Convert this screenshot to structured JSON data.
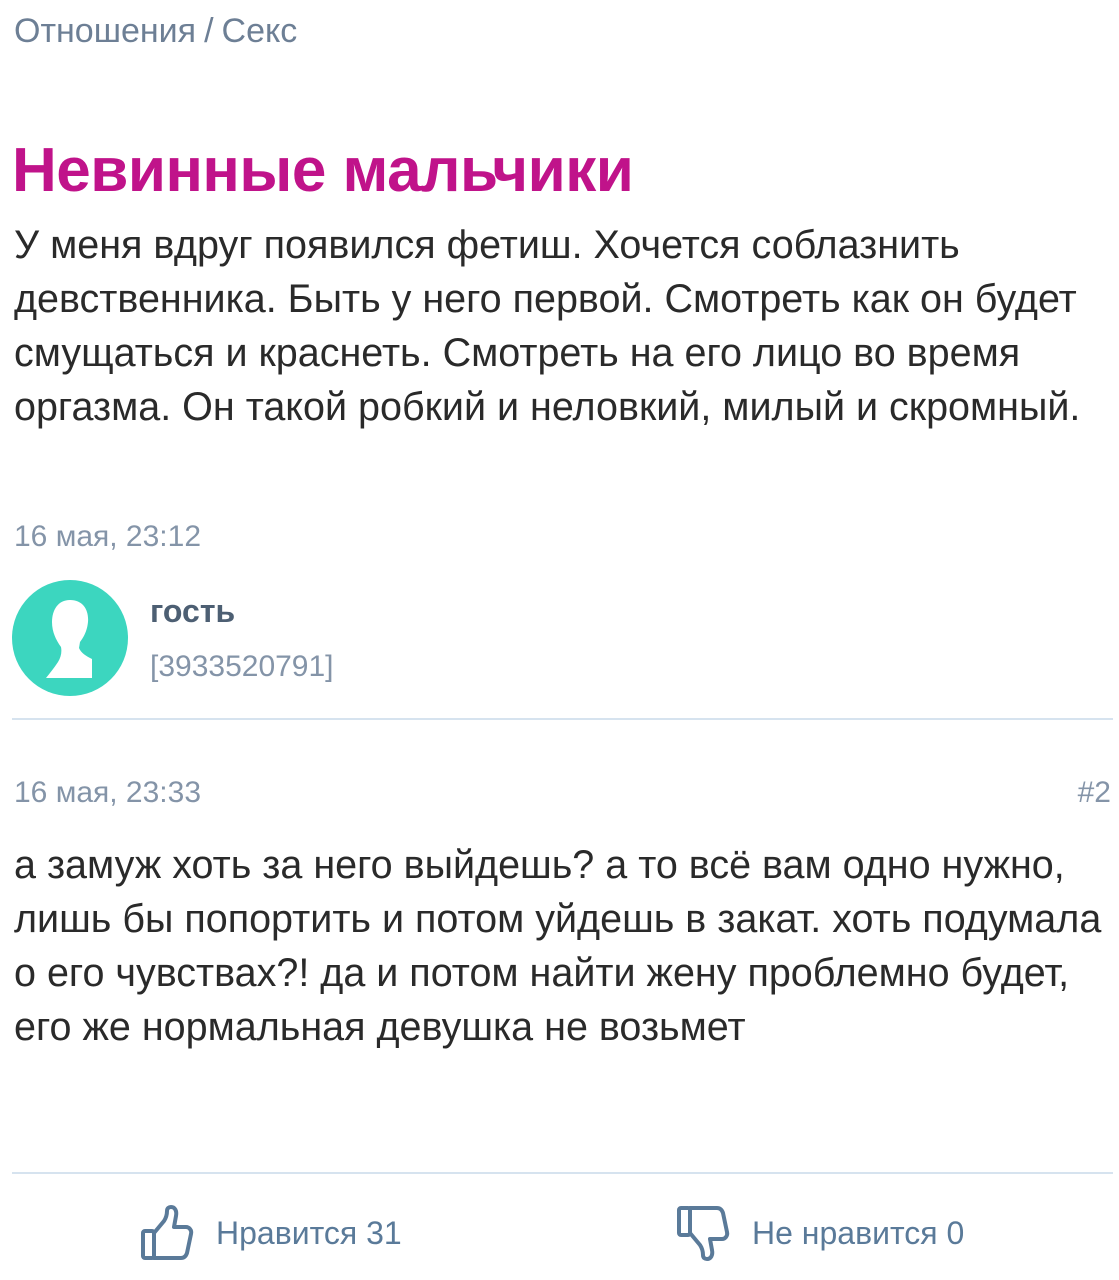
{
  "breadcrumb": {
    "items": [
      "Отношения",
      "Секс"
    ],
    "separator": "/"
  },
  "post": {
    "title": "Невинные мальчики",
    "body": "У меня вдруг появился фетиш. Хочется соблазнить девственника. Быть у него первой. Смотреть как он будет смущаться и краснеть. Смотреть на его лицо во время оргазма. Он такой робкий и неловкий, милый и скромный.",
    "date": "16 мая, 23:12"
  },
  "author": {
    "name": "гость",
    "id": "[3933520791]",
    "avatar_icon": "user-silhouette-icon",
    "avatar_color": "#3cd6bf"
  },
  "comment": {
    "date": "16 мая, 23:33",
    "number": "#2",
    "body": "а замуж хоть за него выйдешь? а то всё вам одно нужно, лишь бы попортить и потом уйдешь в закат. хоть подумала о его чувствах?! да и потом найти жену проблемно будет, его же нормальная девушка не возьмет"
  },
  "votes": {
    "like_label": "Нравится 31",
    "like_icon": "thumbs-up-icon",
    "dislike_label": "Не нравится 0",
    "dislike_icon": "thumbs-down-icon"
  },
  "colors": {
    "title": "#c0138a",
    "muted_text": "#8494a8",
    "breadcrumb": "#6d7f95",
    "vote": "#5a7a99",
    "divider": "#d6e3ef"
  }
}
